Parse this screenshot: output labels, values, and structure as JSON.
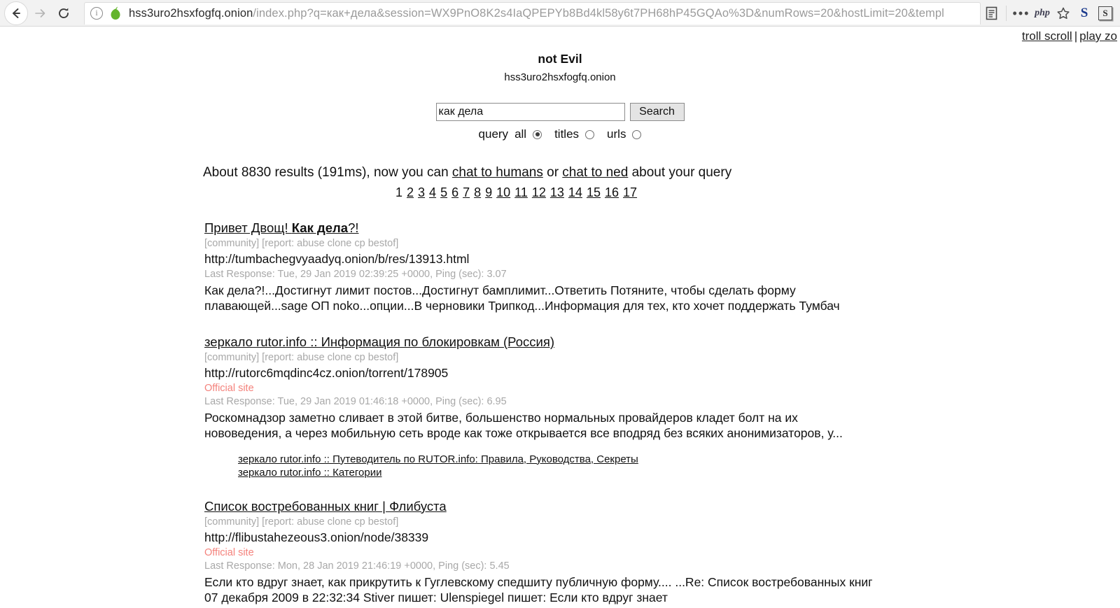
{
  "browser": {
    "back_icon": "back-arrow-icon",
    "forward_icon": "forward-arrow-icon",
    "reload_icon": "reload-icon",
    "info_icon": "info-icon",
    "site_icon": "onion-icon",
    "url_host": "hss3uro2hsxfogfq.onion",
    "url_path": "/index.php?q=как+дела&session=WX9PnO8K2s4IaQPEPYb8Bd4kl58y6t7PH68hP45GQAo%3D&numRows=20&hostLimit=20&templ",
    "reader_icon": "reader-view-icon",
    "menu_dots": "•••",
    "php_label": "php",
    "star_icon": "bookmark-star-icon",
    "ext_s_label": "S",
    "ext_s_box_label": "S"
  },
  "top_links": {
    "troll_scroll": "troll scroll",
    "separator": "|",
    "play_zo": "play zo"
  },
  "header": {
    "title": "not Evil",
    "domain": "hss3uro2hsxfogfq.onion"
  },
  "search": {
    "value": "как дела",
    "placeholder": "",
    "button_label": "Search",
    "query_label": "query",
    "options": [
      {
        "label": "all",
        "checked": true
      },
      {
        "label": "titles",
        "checked": false
      },
      {
        "label": "urls",
        "checked": false
      }
    ]
  },
  "results_meta": {
    "prefix": "About 8830 results (191ms), now you can ",
    "link1": "chat to humans",
    "middle": " or ",
    "link2": "chat to ned",
    "suffix": " about your query",
    "count": "8830",
    "time_ms": "191ms"
  },
  "pagination": {
    "current": "1",
    "pages": [
      "2",
      "3",
      "4",
      "5",
      "6",
      "7",
      "8",
      "9",
      "10",
      "11",
      "12",
      "13",
      "14",
      "15",
      "16",
      "17"
    ]
  },
  "results": [
    {
      "title_plain": "Привет Двощ! ",
      "title_bold": "Как дела",
      "title_tail": "?!",
      "tags": "[community] [report: abuse clone cp bestof]",
      "url": "http://tumbachegvyaadyq.onion/b/res/13913.html",
      "official": "",
      "response": "Last Response: Tue, 29 Jan 2019 02:39:25 +0000, Ping (sec): 3.07",
      "snippet": "Как дела?!...Достигнут лимит постов...Достигнут бамплимит...Ответить Потяните, чтобы сделать форму плавающей...sage ОП noko...опции...В черновики Трипкод...Информация для тех, кто хочет поддержать Тумбач",
      "sublinks": []
    },
    {
      "title_plain": "зеркало rutor.info :: Информация по блокировкам (Россия)",
      "title_bold": "",
      "title_tail": "",
      "tags": "[community] [report: abuse clone cp bestof]",
      "url": "http://rutorc6mqdinc4cz.onion/torrent/178905",
      "official": "Official site",
      "response": "Last Response: Tue, 29 Jan 2019 01:46:18 +0000, Ping (sec): 6.95",
      "snippet": "Роскомнадзор заметно сливает в этой битве, большенство нормальных провайдеров кладет болт на их нововедения, а через мобильную сеть вроде как тоже открывается все вподряд без всяких анонимизаторов, у...",
      "sublinks": [
        "зеркало rutor.info :: Путеводитель по RUTOR.info: Правила, Руководства, Секреты",
        "зеркало rutor.info :: Категории"
      ]
    },
    {
      "title_plain": "Список востребованных книг | Флибуста",
      "title_bold": "",
      "title_tail": "",
      "tags": "[community] [report: abuse clone cp bestof]",
      "url": "http://flibustahezeous3.onion/node/38339",
      "official": "Official site",
      "response": "Last Response: Mon, 28 Jan 2019 21:46:19 +0000, Ping (sec): 5.45",
      "snippet": "Если кто вдруг знает, как прикрутить к Гуглевскому спедшиту публичную форму.... ...Re: Список востребованных книг  07 декабря 2009  в 22:32:34 Stiver пишет:   Ulenspiegel пишет:   Если кто вдруг знает",
      "sublinks": []
    }
  ],
  "colors": {
    "official_site": "#f4827c",
    "muted_text": "#a8a8a8",
    "onion_green": "#63b42c",
    "chrome_bg": "#f2f2f2"
  }
}
